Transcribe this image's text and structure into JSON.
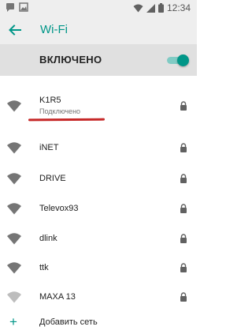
{
  "status_bar": {
    "time": "12:34",
    "left_icons": [
      "message-icon",
      "image-icon"
    ],
    "right_icons": [
      "wifi-signal-icon",
      "cell-signal-icon",
      "battery-icon"
    ]
  },
  "app_bar": {
    "back_icon": "arrow-back-icon",
    "title": "Wi-Fi"
  },
  "master_switch": {
    "label": "ВКЛЮЧЕНО",
    "on": true
  },
  "networks": [
    {
      "name": "K1R5",
      "status": "Подключено",
      "secured": true
    },
    {
      "name": "iNET",
      "secured": true
    },
    {
      "name": "DRIVE",
      "secured": true
    },
    {
      "name": "Televox93",
      "secured": true
    },
    {
      "name": "dlink",
      "secured": true
    },
    {
      "name": "ttk",
      "secured": true
    },
    {
      "name": "MAXA 13",
      "secured": true
    }
  ],
  "add_network": {
    "icon": "plus-icon",
    "label": "Добавить сеть"
  },
  "colors": {
    "accent": "#009688",
    "underline": "#c62828",
    "header_bg": "#eeeeee",
    "master_bg": "#e0e0e0"
  }
}
